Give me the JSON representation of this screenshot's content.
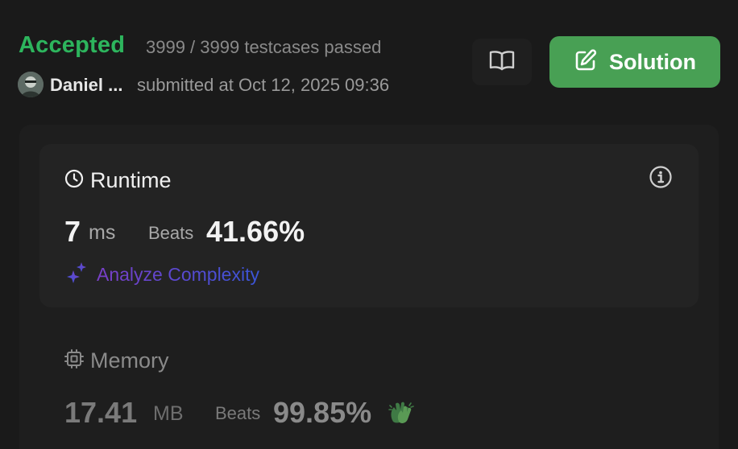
{
  "submission": {
    "status": "Accepted",
    "testcases": "3999 / 3999 testcases passed",
    "user": "Daniel ...",
    "submitted": "submitted at Oct 12, 2025 09:36"
  },
  "actions": {
    "solution_label": "Solution",
    "book_icon": "book-open-icon",
    "solution_icon": "pencil-square-icon"
  },
  "runtime": {
    "title": "Runtime",
    "value": "7",
    "unit": "ms",
    "beats_label": "Beats",
    "beats": "41.66%",
    "analyze_label": "Analyze Complexity"
  },
  "memory": {
    "title": "Memory",
    "value": "17.41",
    "unit": "MB",
    "beats_label": "Beats",
    "beats": "99.85%"
  },
  "colors": {
    "accepted": "#2db55d",
    "solution_button": "#48a054",
    "background": "#1a1a1a",
    "card": "#232323"
  }
}
